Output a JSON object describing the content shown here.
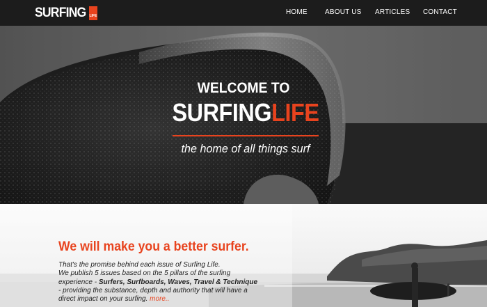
{
  "nav": {
    "logo": {
      "word": "SURFING",
      "badge": "LIFE"
    },
    "items": [
      {
        "label": "HOME"
      },
      {
        "label": "ABOUT US"
      },
      {
        "label": "ARTICLES"
      },
      {
        "label": "CONTACT"
      }
    ]
  },
  "hero": {
    "pre_title": "WELCOME TO",
    "title_main": "SURFING",
    "title_accent": "LIFE",
    "tagline": "the home of all things surf"
  },
  "intro": {
    "heading": "We will make you a better surfer.",
    "line1": "That's the promise behind each issue of Surfing Life.",
    "line2": "We publish 5 issues based on the 5 pillars of the surfing experience - ",
    "pillars": "Surfers, Surfboards, Waves, Travel & Technique",
    "line3": " - providing the substance, depth and authority that will have a direct impact on your surfing.",
    "more_label": "more.."
  },
  "colors": {
    "accent": "#e8431e",
    "nav_bg": "#1c1c1c"
  }
}
